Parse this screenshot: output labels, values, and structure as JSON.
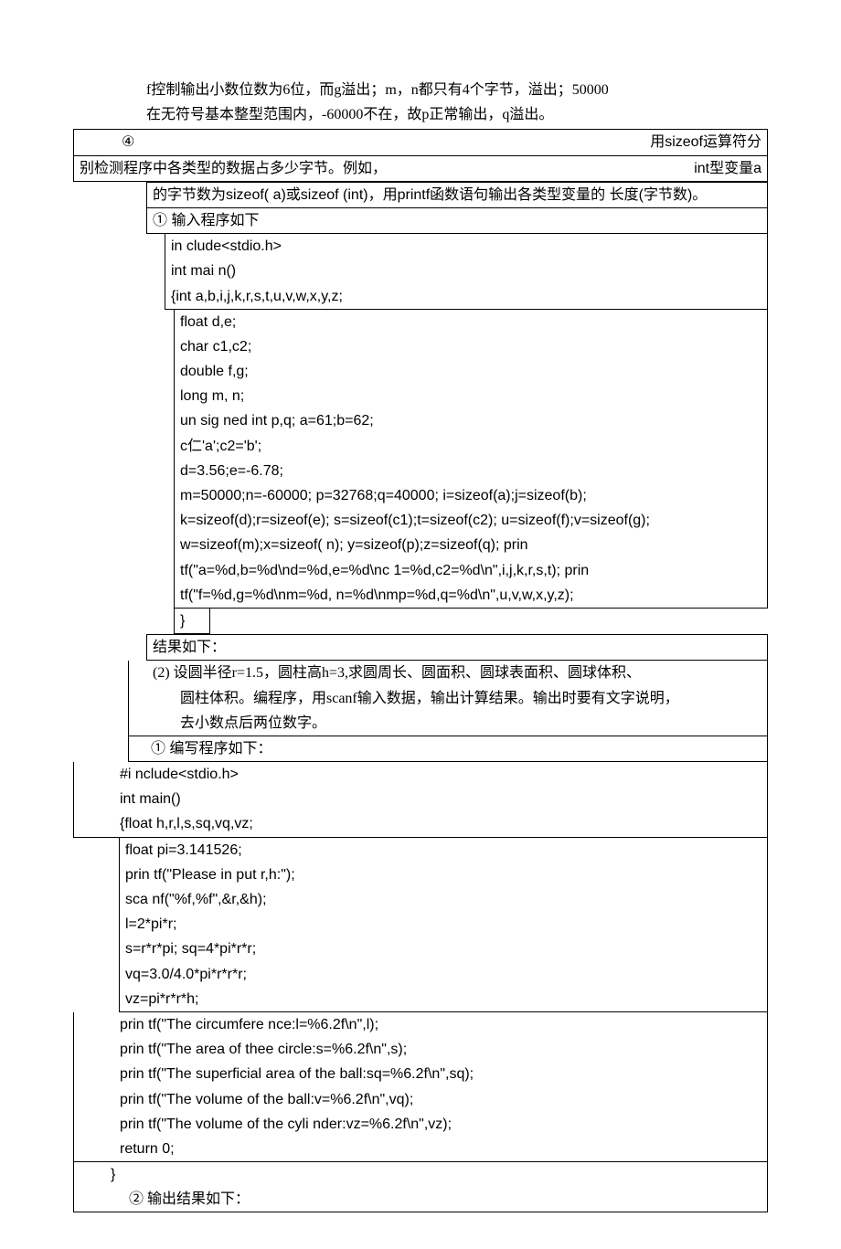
{
  "top": {
    "l1": "f控制输出小数位数为6位，而g溢出；m，n都只有4个字节，溢出；50000",
    "l2": "在无符号基本整型范围内，-60000不在，故p正常输出，q溢出。"
  },
  "row4": {
    "left": "④",
    "right": "用sizeof运算符分"
  },
  "row5": {
    "left": "别检测程序中各类型的数据占多少字节。例如，",
    "right": "int型变量a"
  },
  "row6": "的字节数为sizeof( a)或sizeof (int)，用printf函数语句输出各类型变量的 长度(字节数)。",
  "step1": "①   输入程序如下",
  "code1": [
    "in clude<stdio.h>",
    "int mai n()",
    "{int a,b,i,j,k,r,s,t,u,v,w,x,y,z;"
  ],
  "code2": [
    "float d,e;",
    "char c1,c2;",
    "double f,g;",
    "long m, n;",
    " un sig ned int p,q; a=61;b=62;",
    "c仁'a';c2='b';",
    "d=3.56;e=-6.78;",
    " m=50000;n=-60000; p=32768;q=40000; i=sizeof(a);j=sizeof(b);",
    "k=sizeof(d);r=sizeof(e); s=sizeof(c1);t=sizeof(c2); u=sizeof(f);v=sizeof(g);",
    "w=sizeof(m);x=sizeof( n); y=sizeof(p);z=sizeof(q); prin",
    "tf(\"a=%d,b=%d\\nd=%d,e=%d\\nc 1=%d,c2=%d\\n\",i,j,k,r,s,t); prin",
    "tf(\"f=%d,g=%d\\nm=%d, n=%d\\nmp=%d,q=%d\\n\",u,v,w,x,y,z);"
  ],
  "code2_end": "}",
  "result1": "结果如下：",
  "problem2": [
    "(2)  设圆半径r=1.5，圆柱高h=3,求圆周长、圆面积、圆球表面积、圆球体积、",
    "圆柱体积。编程序，用scanf输入数据，输出计算结果。输出时要有文字说明，",
    "去小数点后两位数字。"
  ],
  "step2": "①    编写程序如下：",
  "code3a": [
    "#i nclude<stdio.h>",
    "int main()",
    "{float h,r,l,s,sq,vq,vz;"
  ],
  "code3b": [
    "float pi=3.141526;",
    "prin tf(\"Please in put r,h:\");",
    "sca nf(\"%f,%f\",&r,&h);",
    "l=2*pi*r;",
    "s=r*r*pi; sq=4*pi*r*r;",
    "vq=3.0/4.0*pi*r*r*r;",
    "vz=pi*r*r*h;"
  ],
  "code3c": [
    "prin tf(\"The circumfere nce:l=%6.2f\\n\",l);",
    "prin tf(\"The area of thee circle:s=%6.2f\\n\",s);",
    "prin tf(\"The superficial area of the ball:sq=%6.2f\\n\",sq);",
    "prin tf(\"The volume of the ball:v=%6.2f\\n\",vq);",
    "prin tf(\"The volume of the cyli nder:vz=%6.2f\\n\",vz);",
    "return 0;"
  ],
  "code3d": "}",
  "step3": "②   输出结果如下："
}
